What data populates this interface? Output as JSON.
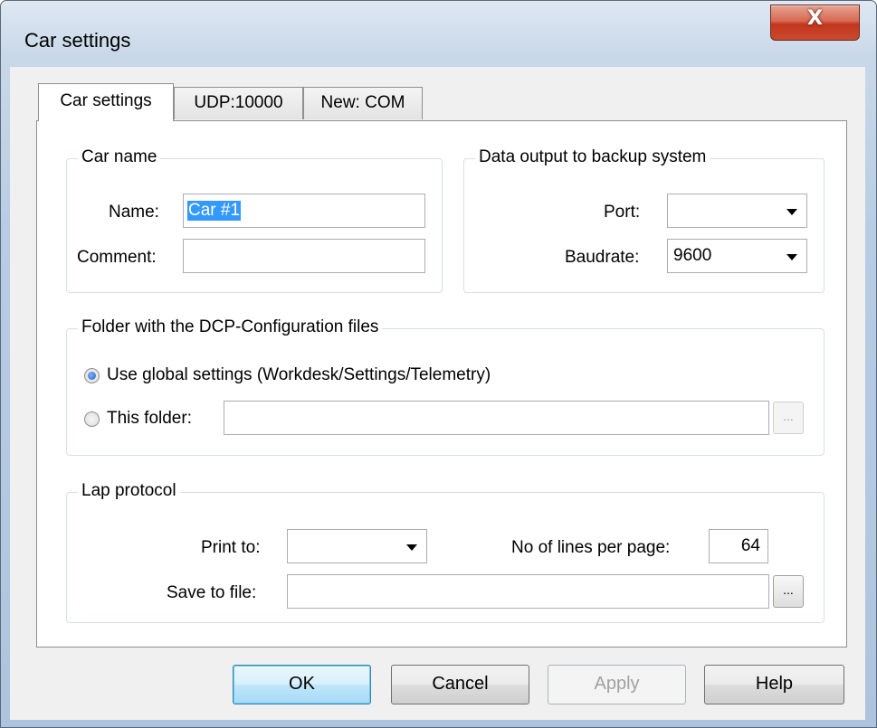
{
  "window": {
    "title": "Car settings",
    "close_label": "X"
  },
  "tabs": [
    {
      "label": "Car settings",
      "active": true
    },
    {
      "label": "UDP:10000",
      "active": false
    },
    {
      "label": "New: COM",
      "active": false
    }
  ],
  "car_name": {
    "legend": "Car name",
    "name_label": "Name:",
    "name_value": "Car #1",
    "comment_label": "Comment:",
    "comment_value": ""
  },
  "data_output": {
    "legend": "Data output to backup system",
    "port_label": "Port:",
    "port_value": "",
    "baudrate_label": "Baudrate:",
    "baudrate_value": "9600"
  },
  "dcp_folder": {
    "legend": "Folder with the DCP-Configuration files",
    "global_label": "Use global settings (Workdesk/Settings/Telemetry)",
    "this_folder_label": "This folder:",
    "this_folder_value": "",
    "browse_label": "...",
    "selected": "global"
  },
  "lap_protocol": {
    "legend": "Lap protocol",
    "print_to_label": "Print to:",
    "print_to_value": "",
    "lines_label": "No of lines per page:",
    "lines_value": "64",
    "save_label": "Save to file:",
    "save_value": "",
    "browse_label": "..."
  },
  "buttons": {
    "ok": "OK",
    "cancel": "Cancel",
    "apply": "Apply",
    "help": "Help"
  }
}
